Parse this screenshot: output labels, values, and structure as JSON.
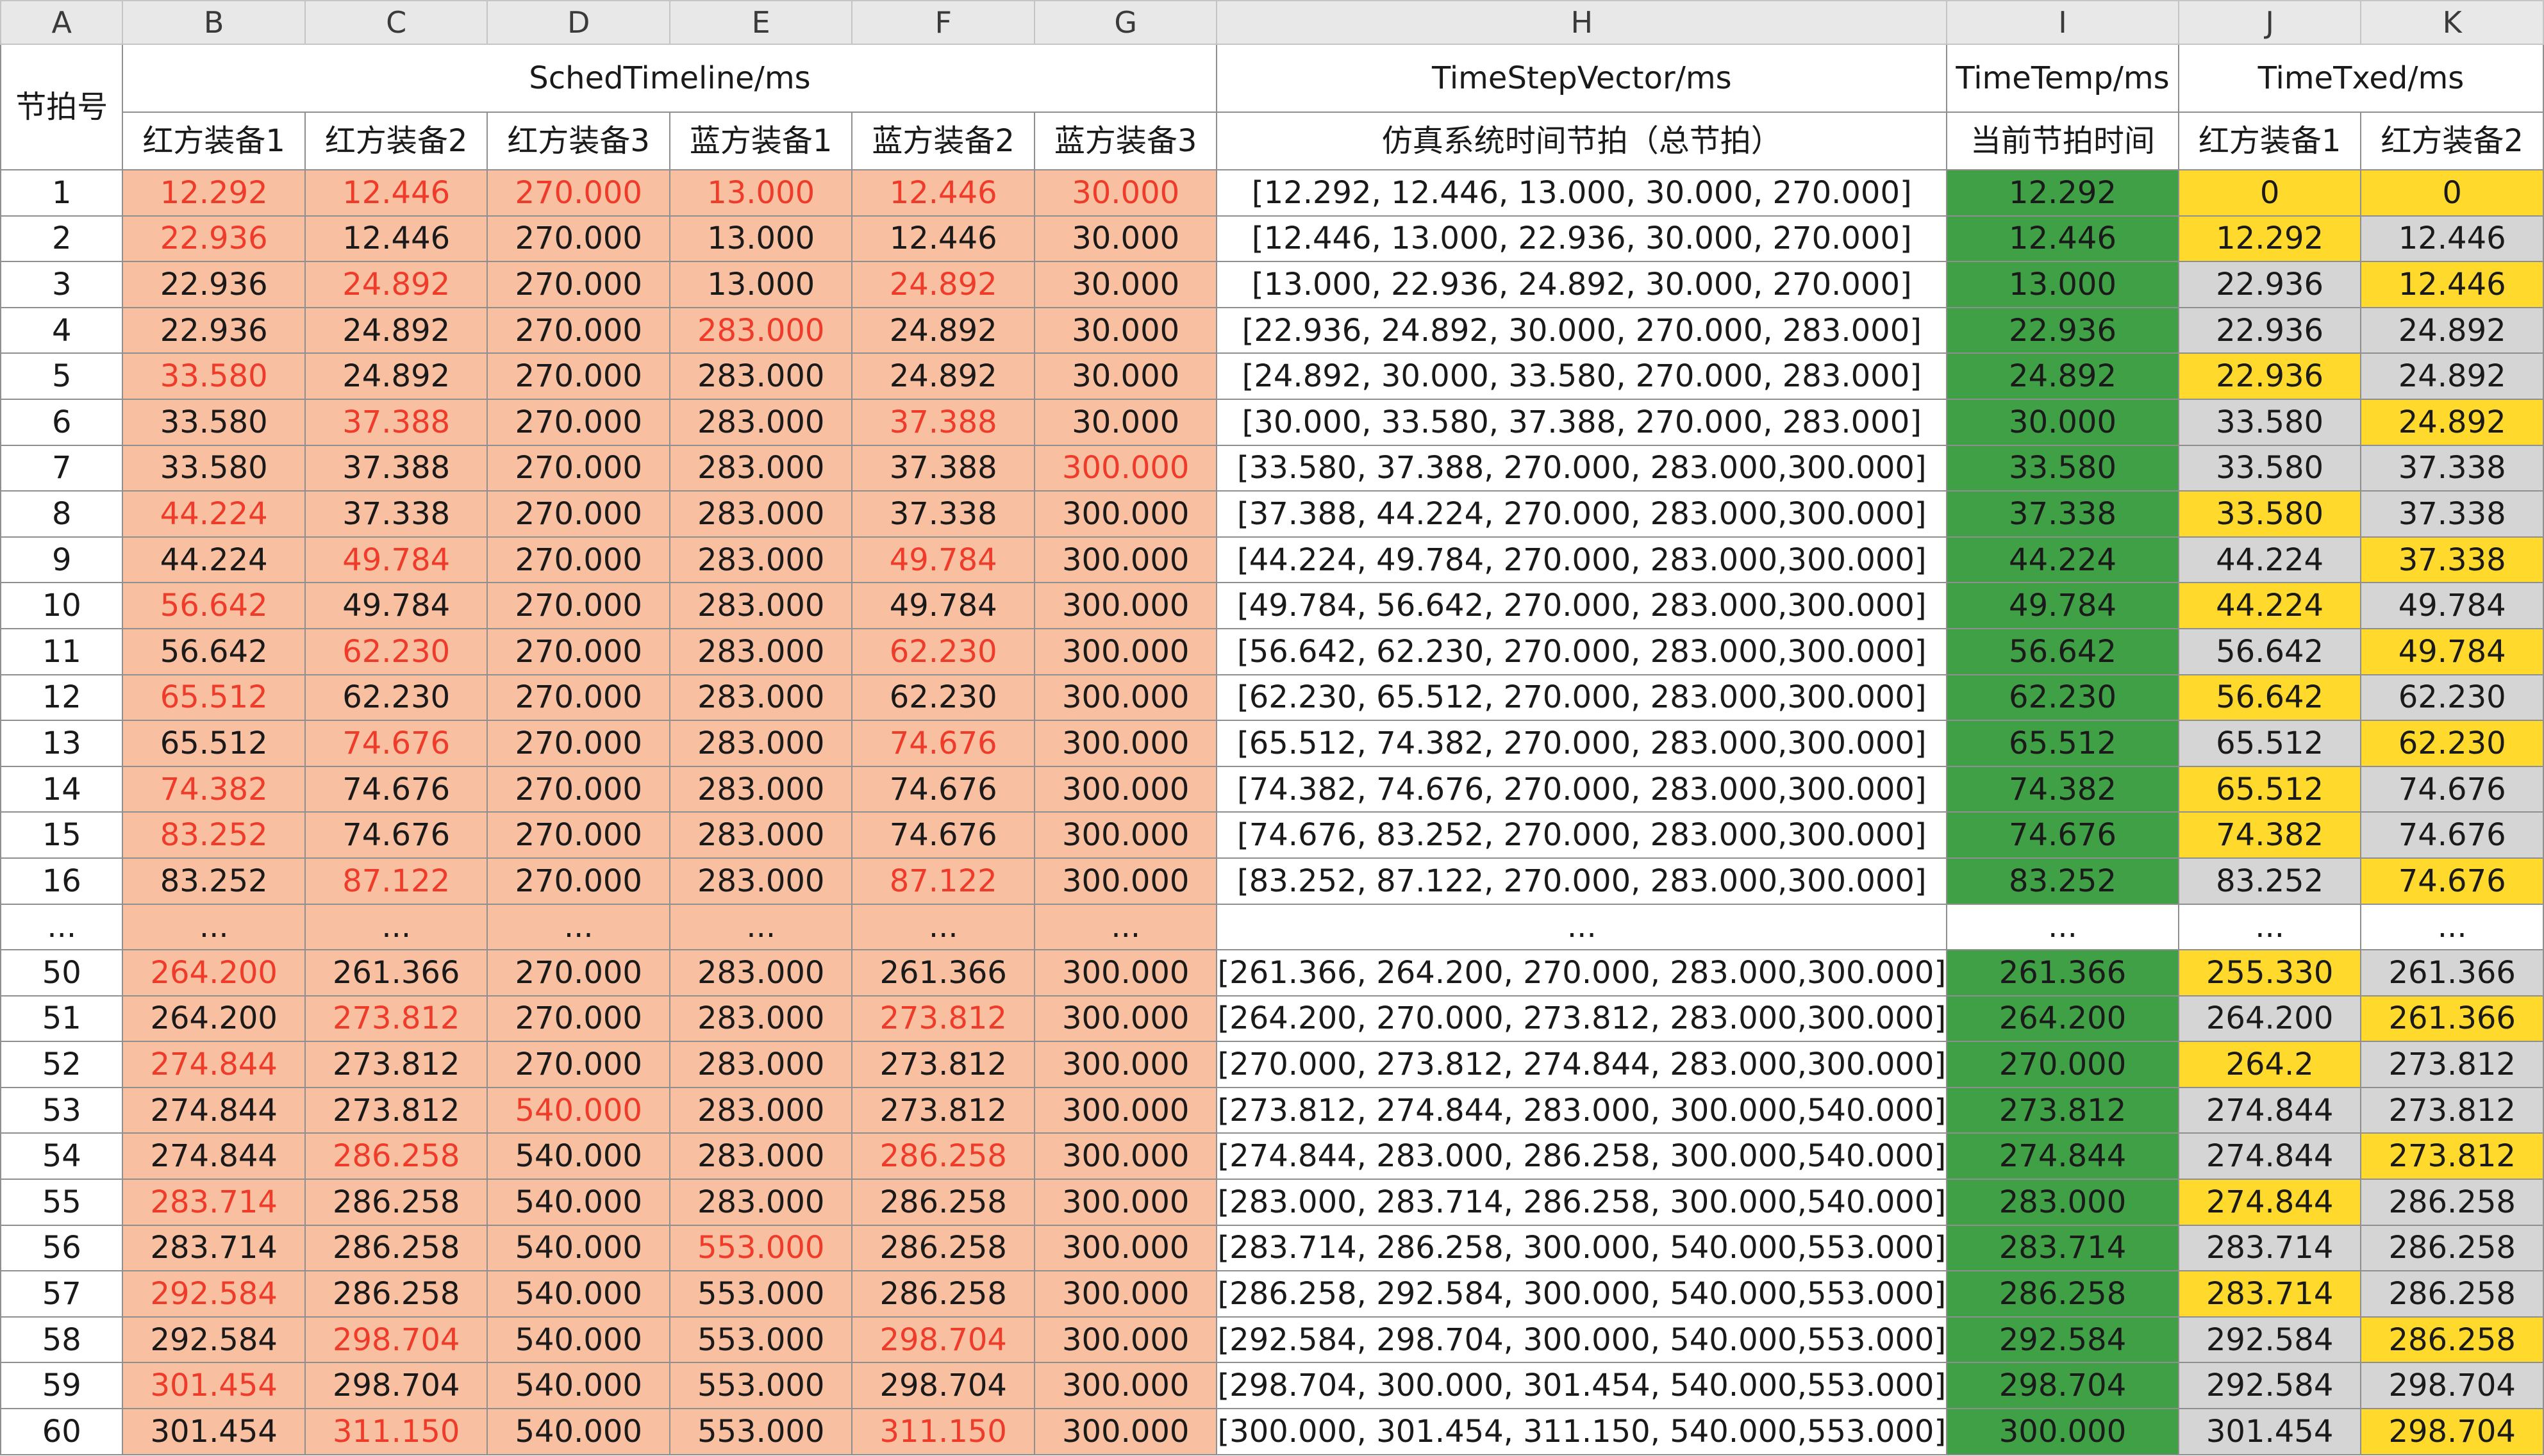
{
  "column_letters": [
    "A",
    "B",
    "C",
    "D",
    "E",
    "F",
    "G",
    "H",
    "I",
    "J",
    "K"
  ],
  "header": {
    "row_label": "节拍号",
    "groups": {
      "sched": "SchedTimeline/ms",
      "vector": "TimeStepVector/ms",
      "temp": "TimeTemp/ms",
      "txed": "TimeTxed/ms"
    },
    "sub": [
      "红方装备1",
      "红方装备2",
      "红方装备3",
      "蓝方装备1",
      "蓝方装备2",
      "蓝方装备3",
      "仿真系统时间节拍（总节拍）",
      "当前节拍时间",
      "红方装备1",
      "红方装备2"
    ]
  },
  "colors": {
    "sched_bg": "#f8bfa0",
    "highlight_text": "#ee3b2a",
    "temp_bg": "#3fa046",
    "txed_yellow": "#ffd92b",
    "txed_grey": "#d5d5d5"
  },
  "rows": [
    {
      "id": "1",
      "sched": [
        "12.292",
        "12.446",
        "270.000",
        "13.000",
        "12.446",
        "30.000"
      ],
      "red": [
        0,
        1,
        2,
        3,
        4,
        5
      ],
      "vector": "[12.292, 12.446, 13.000,   30.000, 270.000]",
      "temp": "12.292",
      "j": "0",
      "k": "0",
      "jy": true,
      "ky": true
    },
    {
      "id": "2",
      "sched": [
        "22.936",
        "12.446",
        "270.000",
        "13.000",
        "12.446",
        "30.000"
      ],
      "red": [
        0
      ],
      "vector": "[12.446, 13.000, 22.936,   30.000, 270.000]",
      "temp": "12.446",
      "j": "12.292",
      "k": "12.446",
      "jy": true,
      "ky": false
    },
    {
      "id": "3",
      "sched": [
        "22.936",
        "24.892",
        "270.000",
        "13.000",
        "24.892",
        "30.000"
      ],
      "red": [
        1,
        4
      ],
      "vector": "[13.000, 22.936, 24.892,   30.000, 270.000]",
      "temp": "13.000",
      "j": "22.936",
      "k": "12.446",
      "jy": false,
      "ky": true
    },
    {
      "id": "4",
      "sched": [
        "22.936",
        "24.892",
        "270.000",
        "283.000",
        "24.892",
        "30.000"
      ],
      "red": [
        3
      ],
      "vector": "[22.936, 24.892, 30.000, 270.000, 283.000]",
      "temp": "22.936",
      "j": "22.936",
      "k": "24.892",
      "jy": false,
      "ky": false
    },
    {
      "id": "5",
      "sched": [
        "33.580",
        "24.892",
        "270.000",
        "283.000",
        "24.892",
        "30.000"
      ],
      "red": [
        0
      ],
      "vector": "[24.892, 30.000, 33.580, 270.000, 283.000]",
      "temp": "24.892",
      "j": "22.936",
      "k": "24.892",
      "jy": true,
      "ky": false
    },
    {
      "id": "6",
      "sched": [
        "33.580",
        "37.388",
        "270.000",
        "283.000",
        "37.388",
        "30.000"
      ],
      "red": [
        1,
        4
      ],
      "vector": "[30.000, 33.580, 37.388, 270.000, 283.000]",
      "temp": "30.000",
      "j": "33.580",
      "k": "24.892",
      "jy": false,
      "ky": true
    },
    {
      "id": "7",
      "sched": [
        "33.580",
        "37.388",
        "270.000",
        "283.000",
        "37.388",
        "300.000"
      ],
      "red": [
        5
      ],
      "vector": "[33.580, 37.388, 270.000, 283.000,300.000]",
      "temp": "33.580",
      "j": "33.580",
      "k": "37.338",
      "jy": false,
      "ky": false
    },
    {
      "id": "8",
      "sched": [
        "44.224",
        "37.338",
        "270.000",
        "283.000",
        "37.338",
        "300.000"
      ],
      "red": [
        0
      ],
      "vector": "[37.388, 44.224, 270.000, 283.000,300.000]",
      "temp": "37.338",
      "j": "33.580",
      "k": "37.338",
      "jy": true,
      "ky": false
    },
    {
      "id": "9",
      "sched": [
        "44.224",
        "49.784",
        "270.000",
        "283.000",
        "49.784",
        "300.000"
      ],
      "red": [
        1,
        4
      ],
      "vector": "[44.224, 49.784, 270.000, 283.000,300.000]",
      "temp": "44.224",
      "j": "44.224",
      "k": "37.338",
      "jy": false,
      "ky": true
    },
    {
      "id": "10",
      "sched": [
        "56.642",
        "49.784",
        "270.000",
        "283.000",
        "49.784",
        "300.000"
      ],
      "red": [
        0
      ],
      "vector": "[49.784, 56.642, 270.000, 283.000,300.000]",
      "temp": "49.784",
      "j": "44.224",
      "k": "49.784",
      "jy": true,
      "ky": false
    },
    {
      "id": "11",
      "sched": [
        "56.642",
        "62.230",
        "270.000",
        "283.000",
        "62.230",
        "300.000"
      ],
      "red": [
        1,
        4
      ],
      "vector": "[56.642, 62.230, 270.000, 283.000,300.000]",
      "temp": "56.642",
      "j": "56.642",
      "k": "49.784",
      "jy": false,
      "ky": true
    },
    {
      "id": "12",
      "sched": [
        "65.512",
        "62.230",
        "270.000",
        "283.000",
        "62.230",
        "300.000"
      ],
      "red": [
        0
      ],
      "vector": "[62.230, 65.512, 270.000, 283.000,300.000]",
      "temp": "62.230",
      "j": "56.642",
      "k": "62.230",
      "jy": true,
      "ky": false
    },
    {
      "id": "13",
      "sched": [
        "65.512",
        "74.676",
        "270.000",
        "283.000",
        "74.676",
        "300.000"
      ],
      "red": [
        1,
        4
      ],
      "vector": "[65.512, 74.382, 270.000, 283.000,300.000]",
      "temp": "65.512",
      "j": "65.512",
      "k": "62.230",
      "jy": false,
      "ky": true
    },
    {
      "id": "14",
      "sched": [
        "74.382",
        "74.676",
        "270.000",
        "283.000",
        "74.676",
        "300.000"
      ],
      "red": [
        0
      ],
      "vector": "[74.382, 74.676, 270.000, 283.000,300.000]",
      "temp": "74.382",
      "j": "65.512",
      "k": "74.676",
      "jy": true,
      "ky": false
    },
    {
      "id": "15",
      "sched": [
        "83.252",
        "74.676",
        "270.000",
        "283.000",
        "74.676",
        "300.000"
      ],
      "red": [
        0
      ],
      "vector": "[74.676, 83.252, 270.000, 283.000,300.000]",
      "temp": "74.676",
      "j": "74.382",
      "k": "74.676",
      "jy": true,
      "ky": false
    },
    {
      "id": "16",
      "sched": [
        "83.252",
        "87.122",
        "270.000",
        "283.000",
        "87.122",
        "300.000"
      ],
      "red": [
        1,
        4
      ],
      "vector": "[83.252, 87.122, 270.000, 283.000,300.000]",
      "temp": "83.252",
      "j": "83.252",
      "k": "74.676",
      "jy": false,
      "ky": true
    },
    {
      "id": "...",
      "sched": [
        "...",
        "...",
        "...",
        "...",
        "...",
        "..."
      ],
      "red": [],
      "vector": "...",
      "temp": "...",
      "j": "...",
      "k": "...",
      "jy": false,
      "ky": false,
      "ellipsis": true
    },
    {
      "id": "50",
      "sched": [
        "264.200",
        "261.366",
        "270.000",
        "283.000",
        "261.366",
        "300.000"
      ],
      "red": [
        0
      ],
      "vector": "[261.366, 264.200, 270.000, 283.000,300.000]",
      "temp": "261.366",
      "j": "255.330",
      "k": "261.366",
      "jy": true,
      "ky": false
    },
    {
      "id": "51",
      "sched": [
        "264.200",
        "273.812",
        "270.000",
        "283.000",
        "273.812",
        "300.000"
      ],
      "red": [
        1,
        4
      ],
      "vector": "[264.200, 270.000, 273.812, 283.000,300.000]",
      "temp": "264.200",
      "j": "264.200",
      "k": "261.366",
      "jy": false,
      "ky": true
    },
    {
      "id": "52",
      "sched": [
        "274.844",
        "273.812",
        "270.000",
        "283.000",
        "273.812",
        "300.000"
      ],
      "red": [
        0
      ],
      "vector": "[270.000, 273.812, 274.844, 283.000,300.000]",
      "temp": "270.000",
      "j": "264.2",
      "k": "273.812",
      "jy": true,
      "ky": false
    },
    {
      "id": "53",
      "sched": [
        "274.844",
        "273.812",
        "540.000",
        "283.000",
        "273.812",
        "300.000"
      ],
      "red": [
        2
      ],
      "vector": "[273.812, 274.844, 283.000, 300.000,540.000]",
      "temp": "273.812",
      "j": "274.844",
      "k": "273.812",
      "jy": false,
      "ky": false
    },
    {
      "id": "54",
      "sched": [
        "274.844",
        "286.258",
        "540.000",
        "283.000",
        "286.258",
        "300.000"
      ],
      "red": [
        1,
        4
      ],
      "vector": "[274.844, 283.000, 286.258, 300.000,540.000]",
      "temp": "274.844",
      "j": "274.844",
      "k": "273.812",
      "jy": false,
      "ky": true
    },
    {
      "id": "55",
      "sched": [
        "283.714",
        "286.258",
        "540.000",
        "283.000",
        "286.258",
        "300.000"
      ],
      "red": [
        0
      ],
      "vector": "[283.000, 283.714, 286.258, 300.000,540.000]",
      "temp": "283.000",
      "j": "274.844",
      "k": "286.258",
      "jy": true,
      "ky": false
    },
    {
      "id": "56",
      "sched": [
        "283.714",
        "286.258",
        "540.000",
        "553.000",
        "286.258",
        "300.000"
      ],
      "red": [
        3
      ],
      "vector": "[283.714, 286.258, 300.000, 540.000,553.000]",
      "temp": "283.714",
      "j": "283.714",
      "k": "286.258",
      "jy": false,
      "ky": false
    },
    {
      "id": "57",
      "sched": [
        "292.584",
        "286.258",
        "540.000",
        "553.000",
        "286.258",
        "300.000"
      ],
      "red": [
        0
      ],
      "vector": "[286.258, 292.584, 300.000, 540.000,553.000]",
      "temp": "286.258",
      "j": "283.714",
      "k": "286.258",
      "jy": true,
      "ky": false
    },
    {
      "id": "58",
      "sched": [
        "292.584",
        "298.704",
        "540.000",
        "553.000",
        "298.704",
        "300.000"
      ],
      "red": [
        1,
        4
      ],
      "vector": "[292.584, 298.704, 300.000, 540.000,553.000]",
      "temp": "292.584",
      "j": "292.584",
      "k": "286.258",
      "jy": false,
      "ky": true
    },
    {
      "id": "59",
      "sched": [
        "301.454",
        "298.704",
        "540.000",
        "553.000",
        "298.704",
        "300.000"
      ],
      "red": [
        0
      ],
      "vector": "[298.704, 300.000, 301.454, 540.000,553.000]",
      "temp": "298.704",
      "j": "292.584",
      "k": "298.704",
      "jy": false,
      "ky": false
    },
    {
      "id": "60",
      "sched": [
        "301.454",
        "311.150",
        "540.000",
        "553.000",
        "311.150",
        "300.000"
      ],
      "red": [
        1,
        4
      ],
      "vector": "[300.000, 301.454, 311.150, 540.000,553.000]",
      "temp": "300.000",
      "j": "301.454",
      "k": "298.704",
      "jy": false,
      "ky": true
    }
  ]
}
